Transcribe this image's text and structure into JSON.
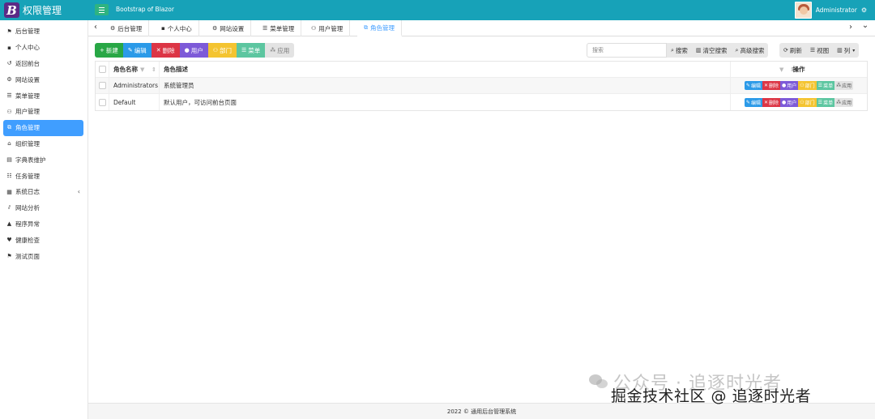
{
  "header": {
    "brand_logo": "B",
    "brand_title": "权限管理",
    "app_title": "Bootstrap of Blazor",
    "user_name": "Administrator",
    "accent_color": "#17a2b8"
  },
  "sidebar": {
    "items": [
      {
        "icon": "flag-icon",
        "glyph": "⚑",
        "label": "后台管理"
      },
      {
        "icon": "briefcase-icon",
        "glyph": "▪",
        "label": "个人中心"
      },
      {
        "icon": "back-icon",
        "glyph": "↺",
        "label": "返回前台"
      },
      {
        "icon": "gear-icon",
        "glyph": "⚙",
        "label": "网站设置"
      },
      {
        "icon": "bars-icon",
        "glyph": "☰",
        "label": "菜单管理"
      },
      {
        "icon": "users-icon",
        "glyph": "👥",
        "label": "用户管理"
      },
      {
        "icon": "sitemap-icon",
        "glyph": "⧉",
        "label": "角色管理",
        "active": true
      },
      {
        "icon": "org-icon",
        "glyph": "⌂",
        "label": "组织管理"
      },
      {
        "icon": "book-icon",
        "glyph": "▤",
        "label": "字典表维护"
      },
      {
        "icon": "tasks-icon",
        "glyph": "☷",
        "label": "任务管理"
      },
      {
        "icon": "log-icon",
        "glyph": "▦",
        "label": "系统日志",
        "caret": "‹"
      },
      {
        "icon": "chart-icon",
        "glyph": "⫽",
        "label": "网站分析"
      },
      {
        "icon": "warning-icon",
        "glyph": "▲",
        "label": "程序异常"
      },
      {
        "icon": "heart-icon",
        "glyph": "♥",
        "label": "健康检查"
      },
      {
        "icon": "flag-icon",
        "glyph": "⚑",
        "label": "测试页面"
      }
    ]
  },
  "tabs": {
    "prev": "‹",
    "next": "›",
    "dropdown": "⌄",
    "items": [
      {
        "icon": "gear-icon",
        "glyph": "⚙",
        "label": "后台管理"
      },
      {
        "icon": "briefcase-icon",
        "glyph": "▪",
        "label": "个人中心"
      },
      {
        "icon": "gear-icon",
        "glyph": "⚙",
        "label": "网站设置"
      },
      {
        "icon": "bars-icon",
        "glyph": "☰",
        "label": "菜单管理"
      },
      {
        "icon": "users-icon",
        "glyph": "👥",
        "label": "用户管理"
      },
      {
        "icon": "sitemap-icon",
        "glyph": "⧉",
        "label": "角色管理",
        "active": true
      }
    ]
  },
  "toolbar": {
    "new": "新建",
    "edit": "编辑",
    "delete": "删除",
    "user": "用户",
    "group": "部门",
    "menu": "菜单",
    "app": "应用"
  },
  "search": {
    "placeholder": "搜索",
    "search": "搜索",
    "clear": "清空搜索",
    "advanced": "高级搜索",
    "refresh": "刷新",
    "view": "视图",
    "columns": "列"
  },
  "table": {
    "columns": {
      "name": "角色名称",
      "desc": "角色描述",
      "ops": "操作"
    },
    "rows": [
      {
        "name": "Administrators",
        "desc": "系统管理员"
      },
      {
        "name": "Default",
        "desc": "默认用户，可访问前台页面"
      }
    ],
    "row_ops": {
      "edit": "编辑",
      "delete": "删除",
      "user": "用户",
      "group": "部门",
      "menu": "菜单",
      "app": "应用"
    }
  },
  "footer": {
    "text": "2022 © 通用后台管理系统"
  },
  "watermark": {
    "line1": "公众号 · 追逐时光者",
    "line2": "掘金技术社区 @ 追逐时光者"
  }
}
